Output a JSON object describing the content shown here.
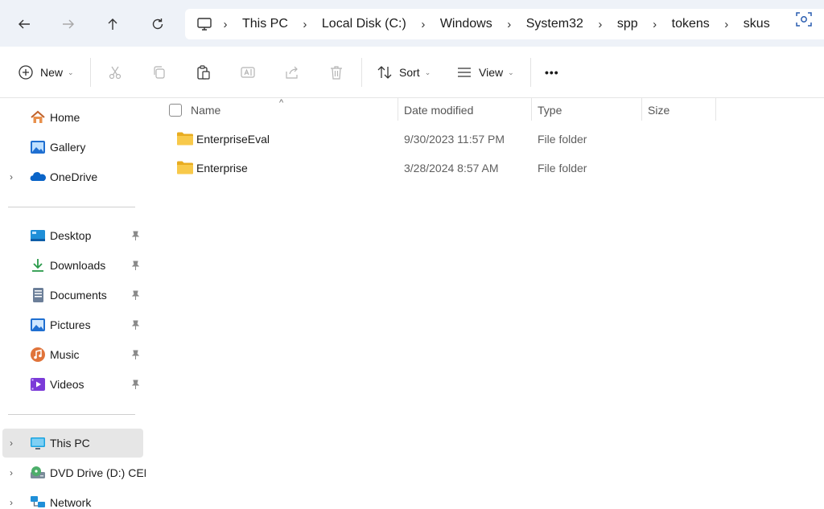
{
  "address_bar": {
    "crumbs": [
      "This PC",
      "Local Disk (C:)",
      "Windows",
      "System32",
      "spp",
      "tokens",
      "skus"
    ],
    "icons": {
      "back": "arrow-left-icon",
      "forward": "arrow-right-icon",
      "up": "arrow-up-icon",
      "refresh": "refresh-icon",
      "pc": "monitor-icon",
      "lens": "visual-search-icon"
    }
  },
  "toolbar": {
    "new_label": "New",
    "sort_label": "Sort",
    "view_label": "View",
    "more_label": "•••",
    "icons": [
      "new-plus-icon",
      "cut-icon",
      "copy-icon",
      "paste-icon",
      "rename-icon",
      "share-icon",
      "delete-icon",
      "sort-icon",
      "view-icon",
      "more-icon"
    ]
  },
  "sidebar": {
    "quick": [
      {
        "label": "Home",
        "icon": "home-icon"
      },
      {
        "label": "Gallery",
        "icon": "gallery-icon"
      },
      {
        "label": "OneDrive",
        "icon": "onedrive-icon"
      }
    ],
    "pinned": [
      {
        "label": "Desktop",
        "icon": "desktop-icon"
      },
      {
        "label": "Downloads",
        "icon": "downloads-icon"
      },
      {
        "label": "Documents",
        "icon": "documents-icon"
      },
      {
        "label": "Pictures",
        "icon": "pictures-icon"
      },
      {
        "label": "Music",
        "icon": "music-icon"
      },
      {
        "label": "Videos",
        "icon": "videos-icon"
      }
    ],
    "drives": [
      {
        "label": "This PC",
        "icon": "this-pc-icon",
        "selected": true
      },
      {
        "label": "DVD Drive (D:) CEN",
        "icon": "dvd-drive-icon"
      },
      {
        "label": "Network",
        "icon": "network-icon"
      }
    ]
  },
  "table": {
    "columns": [
      "Name",
      "Date modified",
      "Type",
      "Size"
    ],
    "sort_indicator": "^",
    "rows": [
      {
        "name": "EnterpriseEval",
        "date": "9/30/2023 11:57 PM",
        "type": "File folder",
        "size": ""
      },
      {
        "name": "Enterprise",
        "date": "3/28/2024 8:57 AM",
        "type": "File folder",
        "size": ""
      }
    ]
  },
  "colors": {
    "accent": "#0067c0",
    "folder": "#f8c94a",
    "selected_bg": "#e6e6e6",
    "address_bg": "#eef2f8"
  }
}
